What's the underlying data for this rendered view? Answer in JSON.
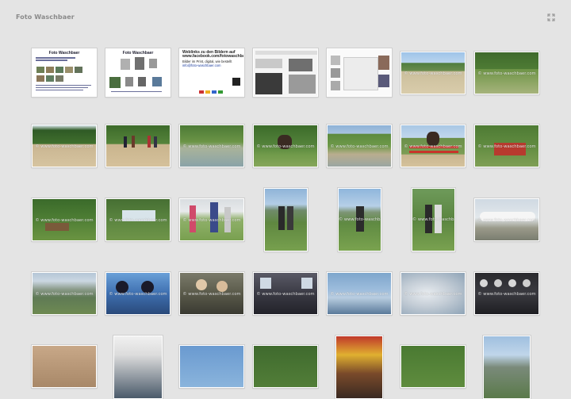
{
  "app": {
    "title": "Foto Waschbaer"
  },
  "icons": {
    "fullscreen": "expand-arrows-icon"
  },
  "docs": {
    "doc1_title": "Foto Waschbaer",
    "doc2_title": "Foto Waschbaer",
    "doc3_line1": "Weblinks zu den Bildern auf",
    "doc3_line2": "www.facebook.com/fotowaschbaer",
    "doc3_line3": "Bilder im Print, digital, wie bestellt",
    "doc3_line4": "info@foto-waschbaer.com"
  },
  "watermark": "© www.foto-waschbaer.com",
  "colors": {
    "background": "#e4e4e4",
    "title": "#8a8a8a"
  }
}
